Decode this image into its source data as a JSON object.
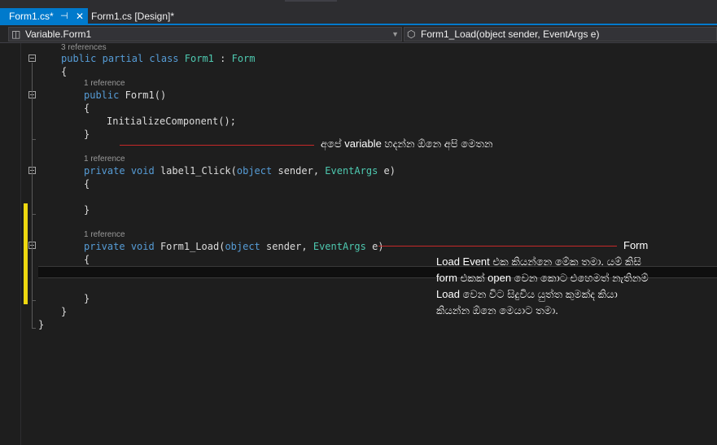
{
  "tabs": [
    {
      "label": "Form1.cs*",
      "pin_glyph": "⊣",
      "close_glyph": "✕"
    },
    {
      "label": "Form1.cs [Design]*"
    }
  ],
  "navigation": {
    "class_dropdown": "Variable.Form1",
    "member_dropdown": "Form1_Load(object sender, EventArgs e)",
    "class_icon": "namespace-icon",
    "member_icon": "method-icon"
  },
  "code": {
    "lens_class": "3 references",
    "lens_ctor": "1 reference",
    "lens_click": "1 reference",
    "lens_load": "1 reference",
    "class_kw1": "public",
    "class_kw2": "partial",
    "class_kw3": "class",
    "class_name": "Form1",
    "class_colon": ":",
    "class_base": "Form",
    "brace_open": "{",
    "brace_close": "}",
    "ctor_kw": "public",
    "ctor_sig": "Form1()",
    "ctor_body": "InitializeComponent();",
    "click_kw1": "private",
    "click_kw2": "void",
    "click_name": "label1_Click(",
    "load_kw1": "private",
    "load_kw2": "void",
    "load_name": "Form1_Load(",
    "param_type1": "object",
    "param_name1": "sender,",
    "param_type2": "EventArgs",
    "param_name2": "e)"
  },
  "annotations": {
    "variable_note": "අපේ variable හදන්න ඕනෙ අපි මෙතන",
    "form_label": "Form",
    "load_note": [
      "Load Event එක කියන්නෙ මේක තමා. යම් කිසි",
      "form එකක් open වෙන කොට එහෙමත් නැතිනම්",
      "Load  වෙන විට සිදුවිය යුත්ත කුමක්ද කියා",
      "කියන්න ඕනෙ මෙයාට තමා."
    ]
  },
  "colors": {
    "accent": "#007acc",
    "keyword": "#569cd6",
    "type": "#4ec9b0",
    "change_bar": "#efd810",
    "annotation_line": "#c62828"
  }
}
